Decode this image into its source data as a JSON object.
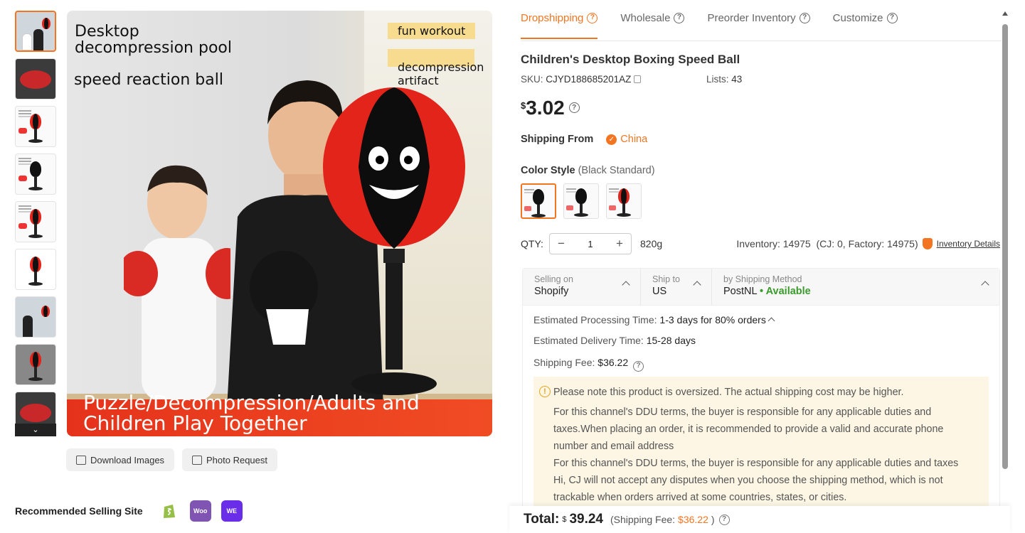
{
  "gallery": {
    "image_texts": {
      "line1": "Desktop decompression pool",
      "line2": "speed reaction ball",
      "tag1": "fun workout",
      "tag2": "decompression artifact",
      "banner": "Puzzle/Decompression/Adults and Children Play Together"
    },
    "download_label": "Download Images",
    "photo_request_label": "Photo Request"
  },
  "recommended": {
    "label": "Recommended Selling Site",
    "sites": [
      "shopify-icon",
      "woocommerce-icon",
      "wee2c-icon"
    ]
  },
  "tabs": [
    {
      "label": "Dropshipping",
      "active": true
    },
    {
      "label": "Wholesale",
      "active": false
    },
    {
      "label": "Preorder Inventory",
      "active": false
    },
    {
      "label": "Customize",
      "active": false
    }
  ],
  "product": {
    "title": "Children's Desktop Boxing Speed Ball",
    "sku_label": "SKU:",
    "sku": "CJYD188685201AZ",
    "lists_label": "Lists:",
    "lists": "43",
    "currency": "$",
    "price": "3.02",
    "shipping_from_label": "Shipping From",
    "shipping_from": "China",
    "color_label": "Color Style",
    "color_selected": "(Black Standard)",
    "qty_label": "QTY:",
    "qty": "1",
    "weight": "820g",
    "inventory": "Inventory: 14975  (CJ: 0, Factory: 14975)",
    "inventory_link": "Inventory Details"
  },
  "shipping": {
    "selling_on_label": "Selling on",
    "selling_on": "Shopify",
    "ship_to_label": "Ship to",
    "ship_to": "US",
    "method_label": "by Shipping Method",
    "method": "PostNL",
    "availability": "• Available",
    "processing_label": "Estimated Processing Time:",
    "processing": "1-3 days for 80% orders",
    "delivery_label": "Estimated Delivery Time:",
    "delivery": "15-28 days",
    "fee_label": "Shipping Fee:",
    "fee": "$36.22",
    "notice_1": "Please note this product is oversized. The actual shipping cost may be higher.",
    "notice_2": "For this channel's DDU terms, the buyer is responsible for any applicable duties and taxes.When placing an order, it is recommended to provide a valid and accurate phone number and email address",
    "notice_3": "For this channel's DDU terms, the buyer is responsible for any applicable duties and taxes",
    "notice_4": "Hi, CJ will not accept any disputes when you choose the shipping method, which is not trackable when orders arrived at some countries, states, or cities."
  },
  "total": {
    "label": "Total:",
    "currency": "$",
    "value": "39.24",
    "fee_prefix": "(Shipping Fee:",
    "fee": "$36.22",
    "fee_suffix": ")"
  },
  "colors": {
    "accent": "#f37521",
    "available": "#3a9b2c",
    "notice_bg": "#fdf6e4"
  }
}
